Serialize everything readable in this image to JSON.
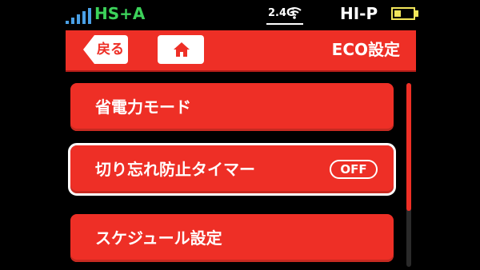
{
  "status_bar": {
    "network_label": "HS+A",
    "band_label": "2.4G",
    "mode_label": "HI-P",
    "battery_level": 0.35,
    "colors": {
      "network": "#3cd25a",
      "signal": "#4aa0e6",
      "battery": "#f2e65a",
      "text": "#ffffff"
    }
  },
  "header": {
    "back_label": "戻る",
    "home_icon": "home-icon",
    "title": "ECO設定",
    "color": "#ee2f26"
  },
  "list": {
    "items": [
      {
        "label": "省電力モード"
      },
      {
        "label": "切り忘れ防止タイマー",
        "toggle": "OFF"
      },
      {
        "label": "スケジュール設定"
      }
    ]
  },
  "scrollbar": {
    "thumb_color": "#ee2f26",
    "track_color": "#2a2a2a"
  }
}
